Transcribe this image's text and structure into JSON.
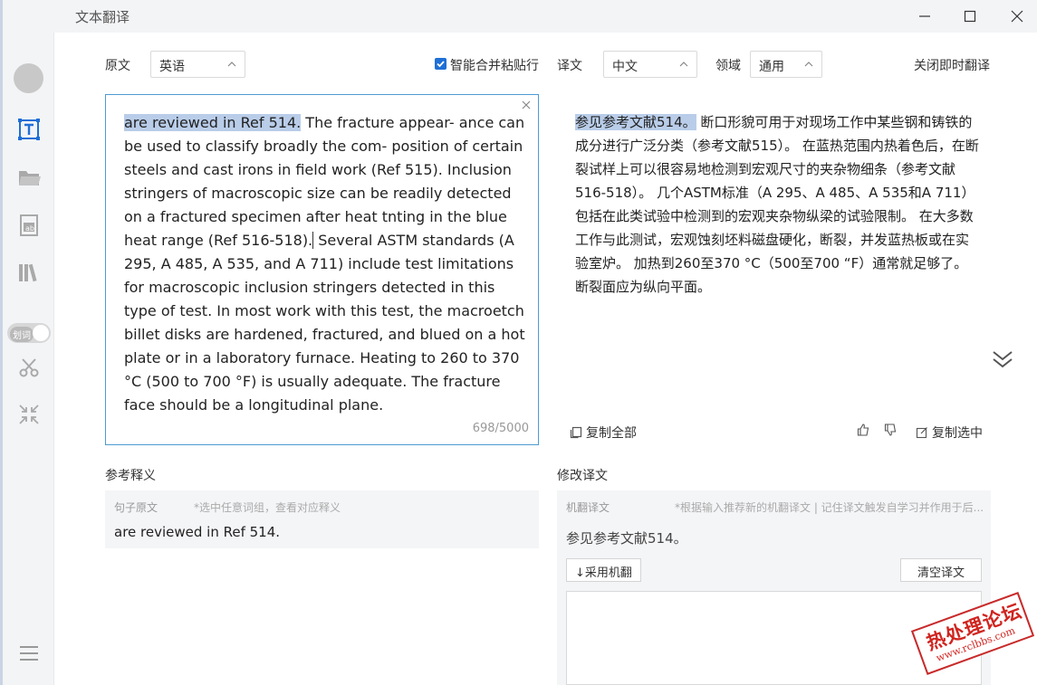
{
  "window": {
    "title": "文本翻译"
  },
  "sidebar": {
    "icons": [
      "avatar",
      "text-translate-icon",
      "folder-icon",
      "document-translate-icon",
      "library-icon",
      "scissors-icon",
      "shrink-icon",
      "menu-icon"
    ],
    "toggle_label": "划词",
    "accent": "#1f6fd6"
  },
  "controls": {
    "source_label": "原文",
    "source_lang": "英语",
    "merge_label": "智能合并粘贴行",
    "merge_checked": true,
    "target_label": "译文",
    "target_lang": "中文",
    "domain_label": "领域",
    "domain_value": "通用",
    "instant_off": "关闭即时翻译"
  },
  "source": {
    "highlight": "are reviewed in Ref 514.",
    "part1": " The fracture appear- ance can be used to classify broadly the com- position of certain steels and cast irons in field work (Ref 515).  Inclusion stringers of macroscopic size can be readily detected on a fractured specimen after heat tnting in the blue heat range (Ref 516-518).",
    "part2": " Several ASTM standards (A 295, A 485, A 535, and A 711) include test limitations for macroscopic inclusion stringers detected in this type of test. In most work with this test, the macroetch billet disks are hardened, fractured, and blued on a hot plate or in a laboratory furnace. Heating to 260 to 370 °C (500 to 700  °F) is usually adequate. The fracture face should be a longitudinal plane.",
    "counter": "698/5000"
  },
  "target": {
    "highlight": "参见参考文献514。",
    "rest": " 断口形貌可用于对现场工作中某些钢和铸铁的成分进行广泛分类（参考文献515）。 在蓝热范围内热着色后，在断裂试样上可以很容易地检测到宏观尺寸的夹杂物细条（参考文献516-518）。 几个ASTM标准（A 295、A 485、A 535和A 711）包括在此类试验中检测到的宏观夹杂物纵梁的试验限制。 在大多数工作与此测试，宏观蚀刻坯料磁盘硬化，断裂，并发蓝热板或在实验室炉。 加热到260至370 °C（500至700 “F）通常就足够了。 断裂面应为纵向平面。",
    "copy_all": "复制全部",
    "copy_selected": "复制选中"
  },
  "reference": {
    "title": "参考释义",
    "col1": "句子原文",
    "hint": "*选中任意词组，查看对应释义",
    "sentence": "are reviewed in Ref 514."
  },
  "edit": {
    "title": "修改译文",
    "col1": "机翻译文",
    "hint": "*根据输入推荐新的机翻译文 | 记住译文触发自学习并作用于后...",
    "machine": "参见参考文献514。",
    "adopt": "↓采用机翻",
    "clear": "清空译文"
  },
  "watermark": {
    "line1": "热处理论坛",
    "line2": "www.rclbbs.com"
  }
}
